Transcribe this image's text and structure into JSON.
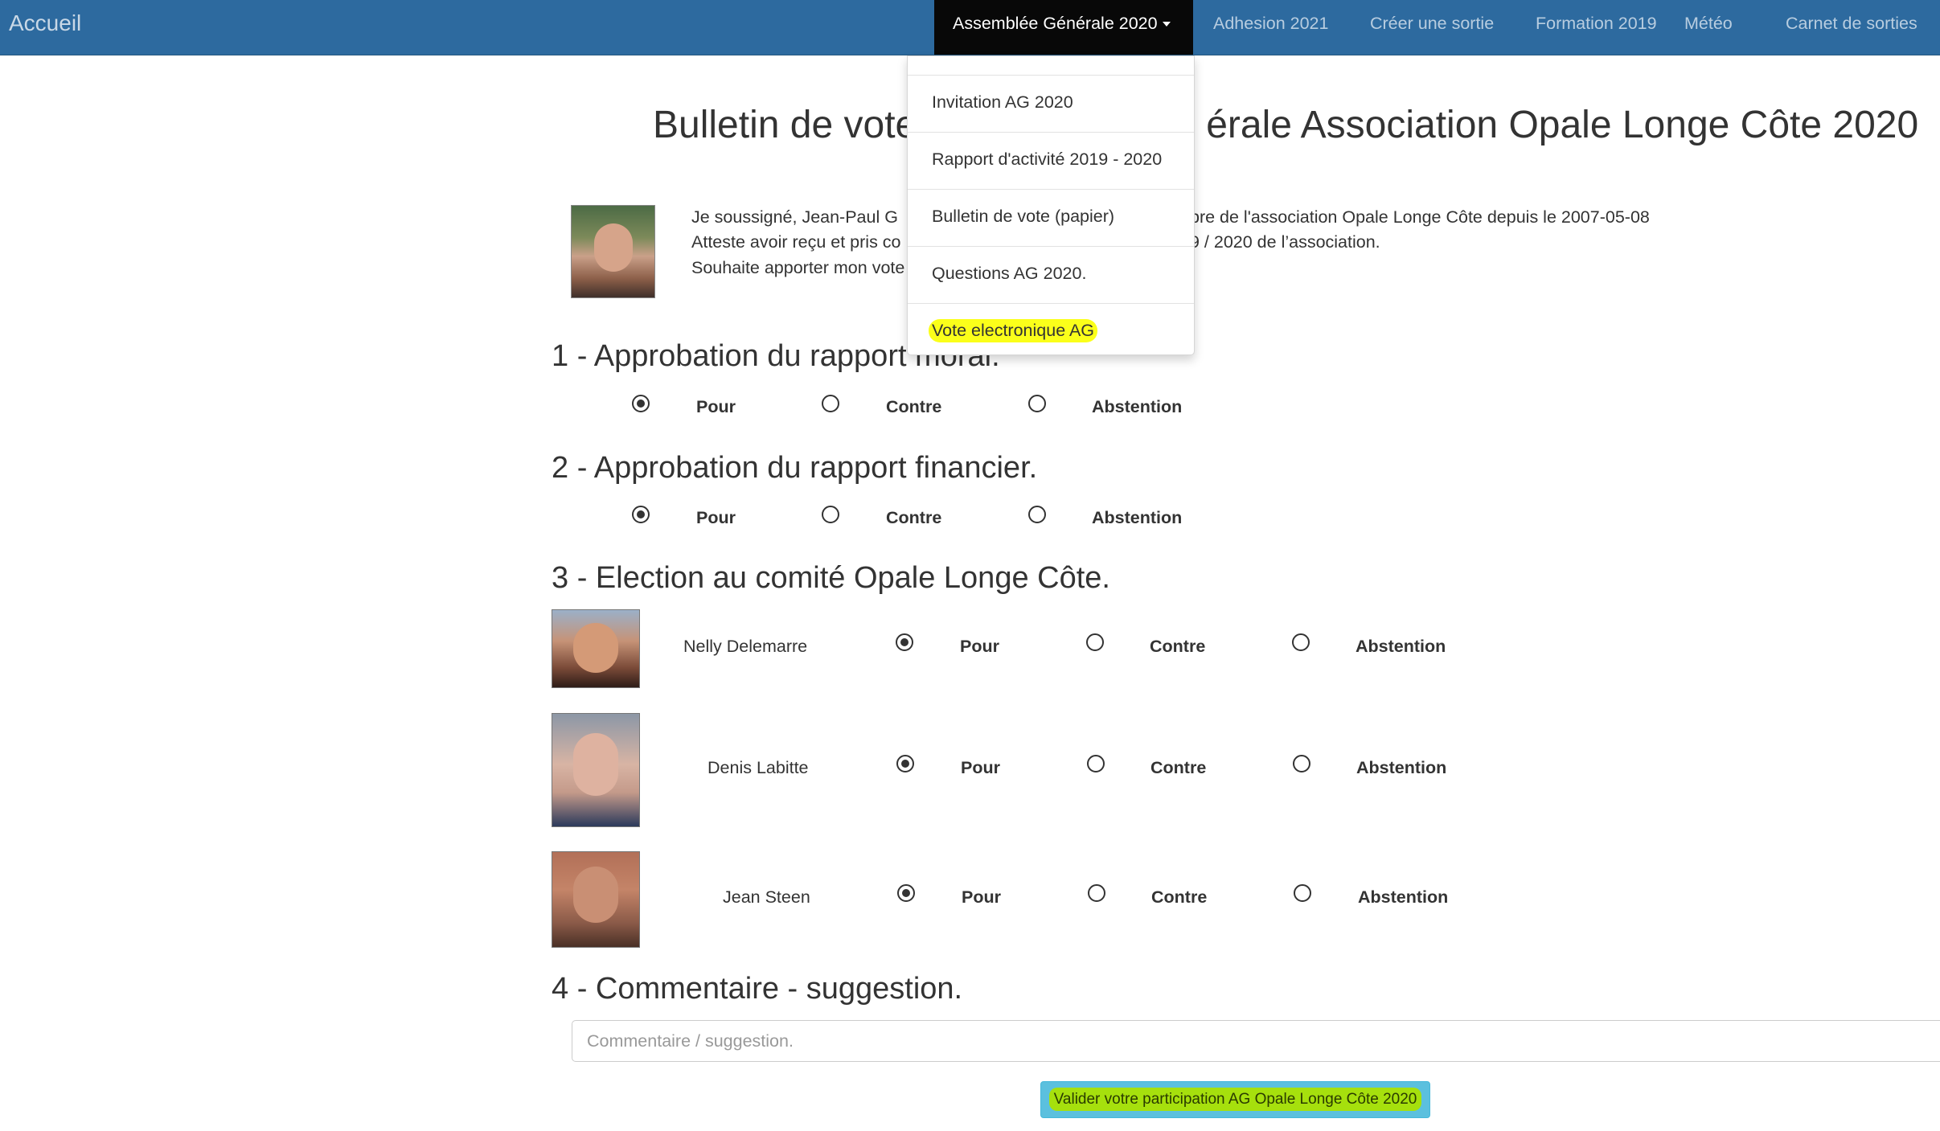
{
  "navbar": {
    "brand": "Accueil",
    "items": [
      {
        "label": "Assemblée Générale 2020",
        "active": true
      },
      {
        "label": "Adhesion 2021"
      },
      {
        "label": "Créer une sortie"
      },
      {
        "label": "Formation 2019"
      },
      {
        "label": "Météo"
      },
      {
        "label": "Carnet de sorties"
      }
    ]
  },
  "dropdown": {
    "items": [
      {
        "label": "Invitation AG 2020"
      },
      {
        "label": "Rapport d'activité 2019 - 2020"
      },
      {
        "label": "Bulletin de vote (papier)"
      },
      {
        "label": "Questions AG 2020."
      },
      {
        "label": "Vote electronique AG",
        "highlighted": true
      }
    ]
  },
  "page": {
    "title_left": "Bulletin de vote",
    "title_right": "érale Association Opale Longe Côte 2020",
    "intro_lines": [
      {
        "left": "Je soussigné, Jean-Paul G",
        "right": "bre de l'association Opale Longe Côte depuis le 2007-05-08"
      },
      {
        "left": "Atteste avoir reçu et pris co",
        "right": "9 / 2020 de l’association."
      },
      {
        "left": "Souhaite apporter mon vote",
        "right": ""
      }
    ]
  },
  "options": {
    "pour": "Pour",
    "contre": "Contre",
    "abstention": "Abstention"
  },
  "sections": [
    {
      "heading": "1 - Approbation du rapport moral.",
      "selected": "pour"
    },
    {
      "heading": "2 - Approbation du rapport financier.",
      "selected": "pour"
    },
    {
      "heading": "3 - Election au comité Opale Longe Côte."
    },
    {
      "heading": "4 - Commentaire - suggestion."
    }
  ],
  "candidates": [
    {
      "name": "Nelly Delemarre",
      "selected": "pour"
    },
    {
      "name": "Denis Labitte",
      "selected": "pour"
    },
    {
      "name": "Jean Steen",
      "selected": "pour"
    }
  ],
  "comment": {
    "placeholder": "Commentaire / suggestion.",
    "value": ""
  },
  "submit": {
    "label": "Valider votre participation AG Opale Longe Côte 2020"
  },
  "colors": {
    "navbar": "#2d6a9f",
    "navbar_active": "#080808",
    "highlight_yellow": "#fbff1a",
    "button": "#5bc0de",
    "button_highlight": "#a6e00d"
  }
}
